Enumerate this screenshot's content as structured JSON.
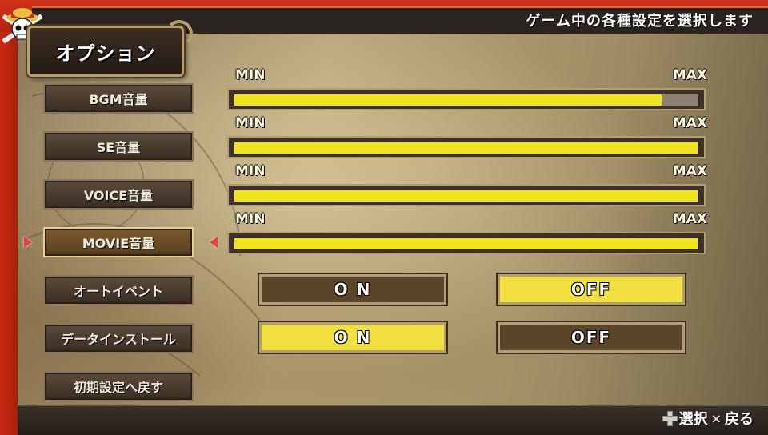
{
  "header": {
    "hint": "ゲーム中の各種設定を選択します",
    "title": "オプション"
  },
  "menu": [
    {
      "label": "BGM音量",
      "selected": false
    },
    {
      "label": "SE音量",
      "selected": false
    },
    {
      "label": "VOICE音量",
      "selected": false
    },
    {
      "label": "MOVIE音量",
      "selected": true
    },
    {
      "label": "オートイベント",
      "selected": false
    },
    {
      "label": "データインストール",
      "selected": false
    },
    {
      "label": "初期設定へ戻す",
      "selected": false
    }
  ],
  "sliders": [
    {
      "min_label": "MIN",
      "max_label": "MAX",
      "value": 0.92
    },
    {
      "min_label": "MIN",
      "max_label": "MAX",
      "value": 1.0
    },
    {
      "min_label": "MIN",
      "max_label": "MAX",
      "value": 1.0
    },
    {
      "min_label": "MIN",
      "max_label": "MAX",
      "value": 1.0
    }
  ],
  "toggles": {
    "auto_event": {
      "on_label": "O N",
      "off_label": "OFF",
      "selected": "OFF"
    },
    "data_install": {
      "on_label": "O N",
      "off_label": "OFF",
      "selected": "ON"
    }
  },
  "footer": {
    "select_label": "選択",
    "back_label": "戻る",
    "cross_glyph": "×"
  },
  "colors": {
    "slider_fill": "#f0e41c",
    "toggle_active": "#f2e040",
    "selection_arrow": "#e84040",
    "header_red": "#c82a14"
  },
  "icons": {
    "emblem": "straw-hat-skull-icon",
    "dpad": "dpad-icon",
    "cursor": "triangle-arrow-icon"
  }
}
